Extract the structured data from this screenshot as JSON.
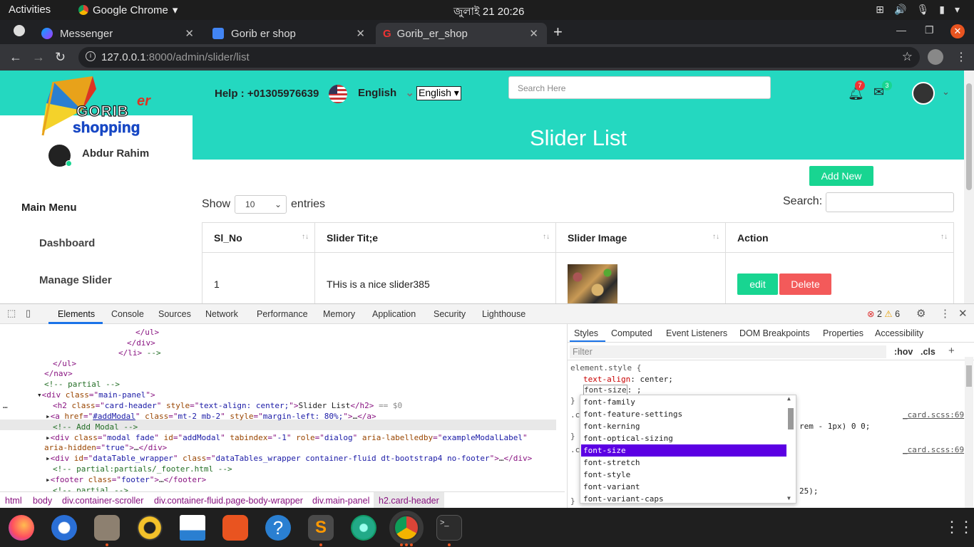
{
  "os": {
    "activities": "Activities",
    "app": "Google Chrome",
    "clock": "জুলাই 21  20:26"
  },
  "browser": {
    "tabs": [
      {
        "title": "Messenger",
        "icon": "messenger-icon"
      },
      {
        "title": "Gorib er shop",
        "icon": "google-icon"
      },
      {
        "title": "Gorib_er_shop",
        "icon": "google-g-icon",
        "active": true
      }
    ],
    "url_host": "127.0.0.1",
    "url_rest": ":8000/admin/slider/list"
  },
  "site": {
    "logo_top": "er",
    "logo_name": "GORIB",
    "logo_sub": "shopping",
    "help": "Help : +01305976639",
    "language_label": "English",
    "language_select": "English",
    "search_placeholder": "Search Here",
    "notifications_count": "7",
    "messages_count": "3",
    "user_name": "Abdur Rahim",
    "main_menu": "Main Menu",
    "menu_items": [
      "Dashboard",
      "Manage Slider"
    ],
    "panel_title": "Slider List",
    "add_new": "Add New",
    "show": "Show",
    "entries_value": "10",
    "entries": "entries",
    "search_label": "Search:",
    "table": {
      "headers": [
        "Sl_No",
        "Slider Tit;e",
        "Slider Image",
        "Action"
      ],
      "rows": [
        {
          "sl": "1",
          "title": "THis is a nice slider385",
          "edit": "edit",
          "delete": "Delete"
        }
      ]
    }
  },
  "devtools": {
    "tabs": [
      "Elements",
      "Console",
      "Sources",
      "Network",
      "Performance",
      "Memory",
      "Application",
      "Security",
      "Lighthouse"
    ],
    "errors": "2",
    "warnings": "6",
    "style_tabs": [
      "Styles",
      "Computed",
      "Event Listeners",
      "DOM Breakpoints",
      "Properties",
      "Accessibility"
    ],
    "filter_placeholder": "Filter",
    "hov": ":hov",
    "cls": ".cls",
    "breadcrumbs": [
      "html",
      "body",
      "div.container-scroller",
      "div.container-fluid.page-body-wrapper",
      "div.main-panel",
      "h2.card-header"
    ],
    "element_style": "element.style {",
    "rule1_prop": "text-align",
    "rule1_val": ": center;",
    "rule2_prop": "font-size",
    "rule2_val": ": ;",
    "source1": "_card.scss:69",
    "source2": "_card.scss:69",
    "partial_text1": "rem - 1px) 0 0;",
    "partial_text2": "25);",
    "autocomplete": [
      "font-family",
      "font-feature-settings",
      "font-kerning",
      "font-optical-sizing",
      "font-size",
      "font-stretch",
      "font-style",
      "font-variant",
      "font-variant-caps"
    ],
    "autocomplete_selected": 4
  }
}
